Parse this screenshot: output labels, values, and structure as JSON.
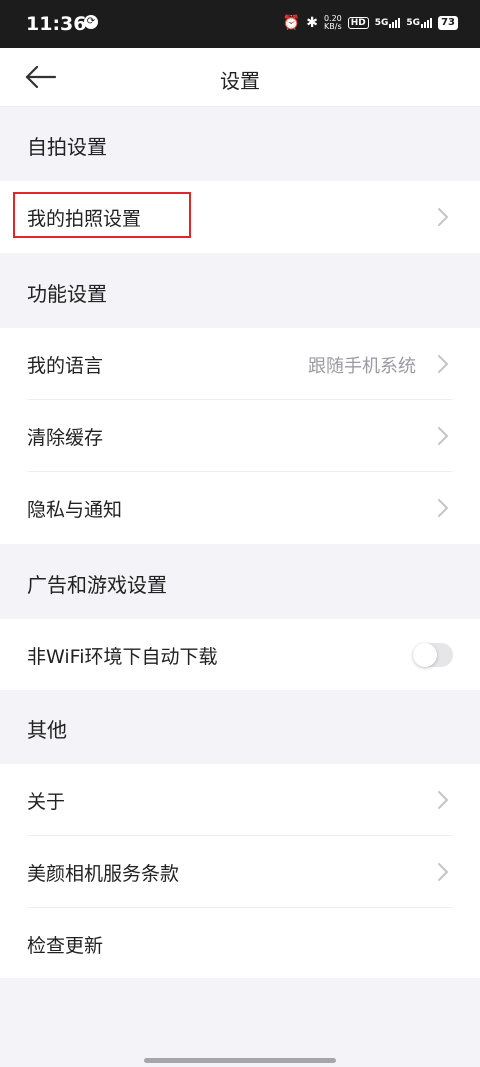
{
  "status_bar": {
    "time": "11:36",
    "speed_top": "0.20",
    "speed_bottom": "KB/s",
    "hd_label": "HD",
    "network_1": "5G",
    "network_2": "5G",
    "battery": "73"
  },
  "header": {
    "title": "设置",
    "back_icon": "arrow-left-icon"
  },
  "sections": {
    "selfie": {
      "title": "自拍设置",
      "items": [
        {
          "label": "我的拍照设置"
        }
      ]
    },
    "function": {
      "title": "功能设置",
      "items": [
        {
          "label": "我的语言",
          "value": "跟随手机系统"
        },
        {
          "label": "清除缓存"
        },
        {
          "label": "隐私与通知"
        }
      ]
    },
    "ads_games": {
      "title": "广告和游戏设置",
      "items": [
        {
          "label": "非WiFi环境下自动下载",
          "toggle_on": false
        }
      ]
    },
    "other": {
      "title": "其他",
      "items": [
        {
          "label": "关于"
        },
        {
          "label": "美颜相机服务条款"
        },
        {
          "label": "检查更新"
        }
      ]
    }
  },
  "colors": {
    "highlight": "#e0262b",
    "background": "#f3f3f8",
    "secondary_text": "#9a9aa2"
  }
}
